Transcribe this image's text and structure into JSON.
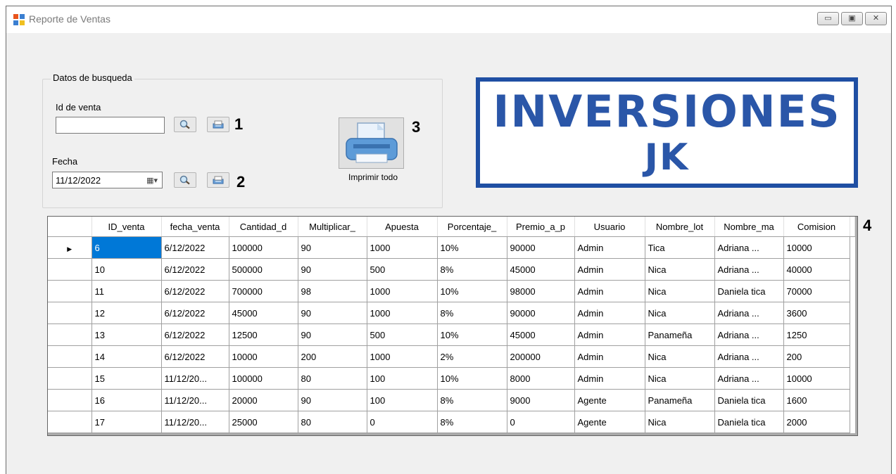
{
  "window": {
    "title": "Reporte de Ventas"
  },
  "search_group": {
    "legend": "Datos de busqueda",
    "id_label": "Id de venta",
    "id_value": "",
    "date_label": "Fecha",
    "date_value": "11/12/2022",
    "search_icon": "magnifier-icon",
    "print_icon": "printer-icon"
  },
  "print_all": {
    "label": "Imprimir todo",
    "icon": "printer-large-icon"
  },
  "annotations": [
    "1",
    "2",
    "3",
    "4"
  ],
  "logo": {
    "line1": "INVERSIONES",
    "line2": "JK",
    "color": "#1f4fa3"
  },
  "grid": {
    "columns": [
      "ID_venta",
      "fecha_venta",
      "Cantidad_d",
      "Multiplicar_",
      "Apuesta",
      "Porcentaje_",
      "Premio_a_p",
      "Usuario",
      "Nombre_lot",
      "Nombre_ma",
      "Comision"
    ],
    "current_row_marker": "▶",
    "selected_color": "#0078d7",
    "rows": [
      [
        "6",
        "6/12/2022",
        "100000",
        "90",
        "1000",
        "10%",
        "90000",
        "Admin",
        "Tica",
        "Adriana ...",
        "10000"
      ],
      [
        "10",
        "6/12/2022",
        "500000",
        "90",
        "500",
        "8%",
        "45000",
        "Admin",
        "Nica",
        "Adriana ...",
        "40000"
      ],
      [
        "11",
        "6/12/2022",
        "700000",
        "98",
        "1000",
        "10%",
        "98000",
        "Admin",
        "Nica",
        "Daniela tica",
        "70000"
      ],
      [
        "12",
        "6/12/2022",
        "45000",
        "90",
        "1000",
        "8%",
        "90000",
        "Admin",
        "Nica",
        "Adriana ...",
        "3600"
      ],
      [
        "13",
        "6/12/2022",
        "12500",
        "90",
        "500",
        "10%",
        "45000",
        "Admin",
        "Panameña",
        "Adriana ...",
        "1250"
      ],
      [
        "14",
        "6/12/2022",
        "10000",
        "200",
        "1000",
        "2%",
        "200000",
        "Admin",
        "Nica",
        "Adriana ...",
        "200"
      ],
      [
        "15",
        "11/12/20...",
        "100000",
        "80",
        "100",
        "10%",
        "8000",
        "Admin",
        "Nica",
        "Adriana ...",
        "10000"
      ],
      [
        "16",
        "11/12/20...",
        "20000",
        "90",
        "100",
        "8%",
        "9000",
        "Agente",
        "Panameña",
        "Daniela tica",
        "1600"
      ],
      [
        "17",
        "11/12/20...",
        "25000",
        "80",
        "0",
        "8%",
        "0",
        "Agente",
        "Nica",
        "Daniela tica",
        "2000"
      ]
    ]
  }
}
